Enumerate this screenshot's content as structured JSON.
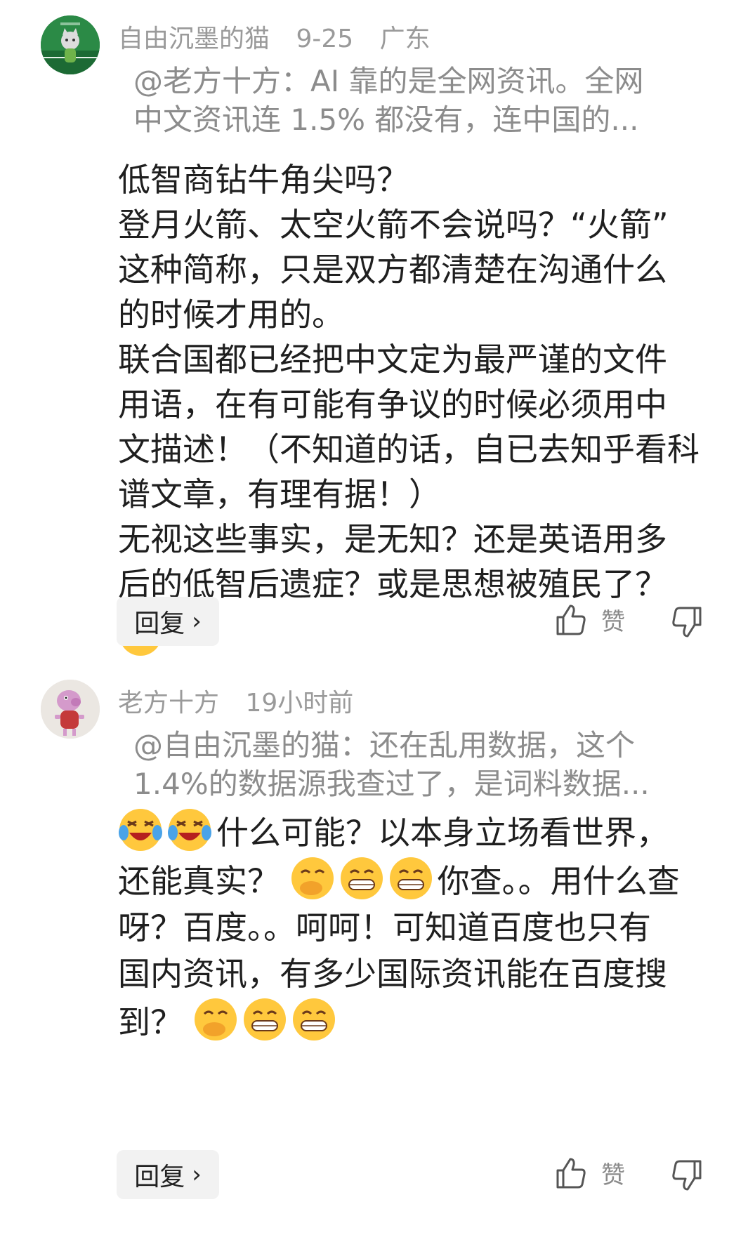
{
  "comments": [
    {
      "author": "自由沉墨的猫",
      "date": "9-25",
      "location": "广东",
      "quote_lines": [
        "@老方十方：AI 靠的是全网资讯。全网",
        "中文资讯连 1.5% 都没有，连中国的..."
      ],
      "body_lines": [
        "低智商钻牛角尖吗？",
        "登月火箭、太空火箭不会说吗？“火箭”",
        "这种简称，只是双方都清楚在沟通什么",
        "的时候才用的。",
        "联合国都已经把中文定为最严谨的文件",
        "用语，在有可能有争议的时候必须用中",
        "文描述！（不知道的话，自已去知乎看科",
        "谱文章，有理有据！）",
        "无视这些事实，是无知？还是英语用多",
        "后的低智后遗症？或是思想被殖民了？"
      ],
      "trailing_emoji": "laughing-tears-emoji",
      "reply_label": "回复",
      "like_label": "赞"
    },
    {
      "author": "老方十方",
      "date": "19小时前",
      "quote_lines": [
        "@自由沉墨的猫：还在乱用数据，这个",
        "1.4%的数据源我查过了，是词料数据..."
      ],
      "body_line1_text": "什么可能？以本身立场看世界，",
      "body_line2_text_a": "还能真实？",
      "body_line2_text_b": "你查。。用什么查",
      "body_line3": "呀？百度。。呵呵！可知道百度也只有",
      "body_line4": "国内资讯，有多少国际资讯能在百度搜",
      "body_line5_text": "到？",
      "reply_label": "回复",
      "like_label": "赞"
    }
  ],
  "colors": {
    "meta": "#9a9a9a",
    "quote": "#8c8c8c",
    "body": "#1f1f1f",
    "reply_bg": "#f2f2f2",
    "emoji_face": "#ffc83d"
  }
}
